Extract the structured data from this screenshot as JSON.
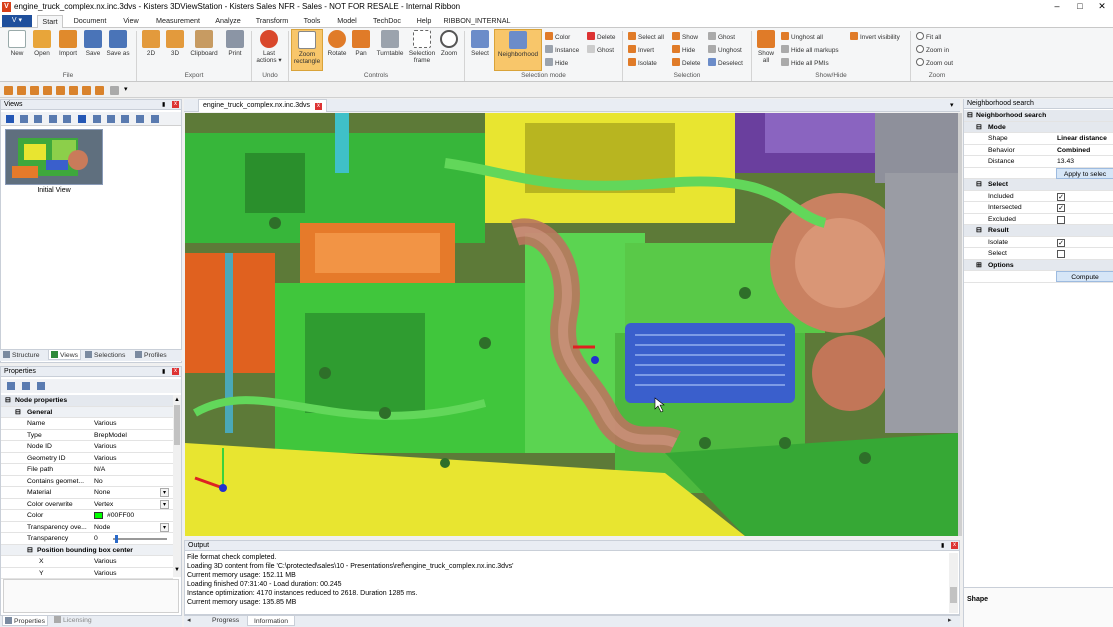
{
  "window": {
    "title": "engine_truck_complex.nx.inc.3dvs - Kisters 3DViewStation - Kisters Sales NFR - Sales - NOT FOR RESALE - Internal Ribbon",
    "logo_letter": "V",
    "app_button": "V ▾",
    "minimize": "–",
    "maximize": "□",
    "close": "✕"
  },
  "menu_tabs": [
    "Start",
    "Document",
    "View",
    "Measurement",
    "Analyze",
    "Transform",
    "Tools",
    "Model",
    "TechDoc",
    "Help",
    "RIBBON_INTERNAL"
  ],
  "ribbon": {
    "file": {
      "label": "File",
      "buttons": [
        "New",
        "Open",
        "Import",
        "Save",
        "Save as"
      ]
    },
    "export": {
      "label": "Export",
      "buttons": [
        "2D",
        "3D",
        "Clipboard",
        "Print"
      ]
    },
    "undo": {
      "label": "Undo",
      "buttons": [
        "Last actions ▾"
      ]
    },
    "controls": {
      "label": "Controls",
      "buttons": [
        "Zoom rectangle",
        "Rotate",
        "Pan",
        "Turntable",
        "Selection frame",
        "Zoom"
      ]
    },
    "selection_mode": {
      "label": "Selection mode",
      "buttons": [
        "Select",
        "Neighborhood"
      ],
      "small": [
        "Color",
        "Instance",
        "Hide",
        "Delete",
        "Ghost"
      ]
    },
    "selection": {
      "label": "Selection",
      "small": [
        "Select all",
        "Invert",
        "Isolate",
        "Show",
        "Hide",
        "Delete",
        "Ghost",
        "Unghost",
        "Deselect"
      ]
    },
    "show_hide": {
      "label": "Show/Hide",
      "buttons": [
        "Show all"
      ],
      "small": [
        "Unghost all",
        "Hide all markups",
        "Hide all PMIs",
        "Invert visibility"
      ]
    },
    "zoom": {
      "label": "Zoom",
      "small": [
        "Fit all",
        "Zoom in",
        "Zoom out"
      ]
    }
  },
  "views_panel": {
    "title": "Views",
    "thumbnail_label": "Initial View",
    "tabs": [
      "Structure",
      "Views",
      "Selections",
      "Profiles"
    ]
  },
  "properties_panel": {
    "title": "Properties",
    "section": "Node properties",
    "group": "General",
    "rows": [
      {
        "k": "Name",
        "v": "Various"
      },
      {
        "k": "Type",
        "v": "BrepModel"
      },
      {
        "k": "Node ID",
        "v": "Various"
      },
      {
        "k": "Geometry ID",
        "v": "Various"
      },
      {
        "k": "File path",
        "v": "N/A"
      },
      {
        "k": "Contains geomet...",
        "v": "No"
      },
      {
        "k": "Material",
        "v": "None"
      },
      {
        "k": "Color overwrite",
        "v": "Vertex"
      },
      {
        "k": "Color",
        "v": "#00FF00"
      },
      {
        "k": "Transparency ove...",
        "v": "Node"
      },
      {
        "k": "Transparency",
        "v": "0"
      }
    ],
    "subsection": "Position bounding box center",
    "sub_rows": [
      {
        "k": "X",
        "v": "Various"
      },
      {
        "k": "Y",
        "v": "Various"
      }
    ],
    "tabs": [
      "Properties",
      "Licensing"
    ],
    "color_swatch": "#00ff00"
  },
  "document_tab": {
    "label": "engine_truck_complex.nx.inc.3dvs"
  },
  "output_panel": {
    "title": "Output",
    "lines": [
      "File format check completed.",
      "Loading 3D content from file 'C:\\protected\\sales\\10 - Presentations\\ref\\engine_truck_complex.nx.inc.3dvs'",
      "Current memory usage: 152.11 MB",
      "Loading finished 07:31:40 - Load duration: 00.245",
      "Instance optimization: 4170 instances reduced to 2618. Duration 1285 ms.",
      "Current memory usage: 135.85 MB"
    ],
    "tabs": [
      "Progress",
      "Information"
    ]
  },
  "neighborhood_panel": {
    "title": "Neighborhood search",
    "section": "Neighborhood search",
    "mode": {
      "label": "Mode",
      "rows": [
        {
          "k": "Shape",
          "v": "Linear distance"
        },
        {
          "k": "Behavior",
          "v": "Combined"
        },
        {
          "k": "Distance",
          "v": "13.43"
        }
      ]
    },
    "apply_button": "Apply to selec",
    "select": {
      "label": "Select",
      "rows": [
        {
          "k": "Included",
          "checked": true
        },
        {
          "k": "Intersected",
          "checked": true
        },
        {
          "k": "Excluded",
          "checked": false
        }
      ]
    },
    "result": {
      "label": "Result",
      "rows": [
        {
          "k": "Isolate",
          "checked": true
        },
        {
          "k": "Select",
          "checked": false
        }
      ]
    },
    "options": "Options",
    "compute_button": "Compute",
    "help_title": "Shape"
  },
  "colors": {
    "accent": "#1f4f9c",
    "active_tool": "#f8c66a",
    "engine_green": "#38c33a",
    "engine_yellow": "#e8e530",
    "engine_orange": "#e67a2a",
    "cooler_blue": "#3a5fcc",
    "turbo_copper": "#d48a5c",
    "viewport_bg": "#6f8a3f"
  }
}
